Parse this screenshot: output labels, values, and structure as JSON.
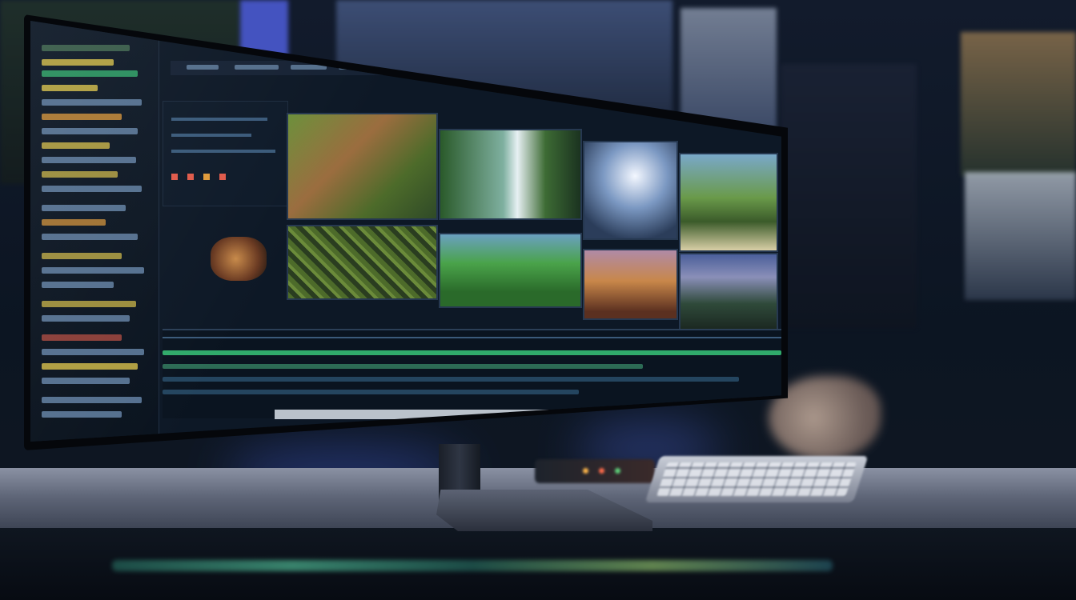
{
  "scene": {
    "description_colors": {
      "screen_bg": "#0d1826",
      "accent_green": "#3ddc84",
      "accent_yellow": "#d8c04a",
      "accent_red": "#e05a4a",
      "ambient_blue": "#4e6cff"
    }
  },
  "editor": {
    "timeline_tracks": 4,
    "clips": [
      "forest-canyon-clip",
      "waterfall-clip",
      "light-burst-clip",
      "coastal-trees-clip",
      "mossy-hills-clip",
      "green-valley-clip",
      "desert-rock-clip",
      "pine-sky-clip"
    ]
  }
}
